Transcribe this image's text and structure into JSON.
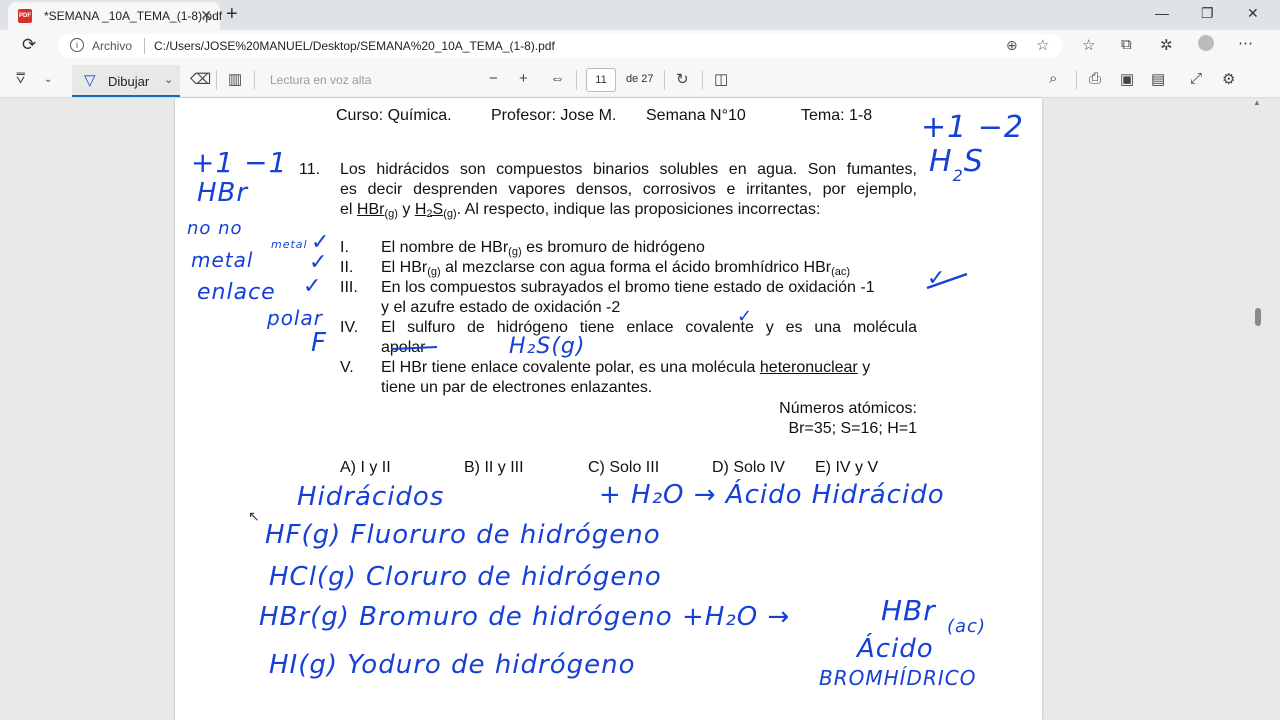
{
  "browser": {
    "tab_title": "*SEMANA _10A_TEMA_(1-8).pdf",
    "address_label": "Archivo",
    "url": "C:/Users/JOSE%20MANUEL/Desktop/SEMANA%20_10A_TEMA_(1-8).pdf"
  },
  "pdf_toolbar": {
    "draw_label": "Dibujar",
    "read_aloud_label": "Lectura en voz alta",
    "current_page": "11",
    "page_of": "de 27"
  },
  "document": {
    "header": {
      "course": "Curso: Química.",
      "teacher": "Profesor: Jose M.",
      "week": "Semana N°10",
      "topic": "Tema: 1-8"
    },
    "question_number": "11.",
    "intro_line1": "Los hidrácidos son compuestos binarios solubles en agua. Son fumantes,",
    "intro_line2": "es decir desprenden vapores densos, corrosivos e irritantes, por ejemplo,",
    "intro_el": "el",
    "intro_hbr": "HBr",
    "state_g": "(g)",
    "intro_y": "y",
    "intro_h2s": "H",
    "intro_h2s_sub": "2",
    "intro_h2s_s": "S",
    "intro_tail": ". Al respecto, indique las proposiciones incorrectas:",
    "roman_1": "I.",
    "prop_1a": "El nombre de HBr",
    "prop_1b": " es bromuro de hidrógeno",
    "roman_2": "II.",
    "prop_2a": "El HBr",
    "prop_2b": " al mezclarse con agua forma el ácido bromhídrico HBr",
    "state_ac": "(ac)",
    "roman_3": "III.",
    "prop_3_line1": "En los compuestos subrayados el bromo tiene estado de oxidación -1",
    "prop_3_line2": "y el azufre estado de oxidación -2",
    "roman_4": "IV.",
    "prop_4_line1": "El sulfuro de hidrógeno tiene enlace covalente y es una molécula",
    "prop_4_line2": "apolar",
    "roman_5": "V.",
    "prop_5a": "El HBr tiene enlace covalente polar, es una molécula",
    "prop_5_underlined": "heteronuclear",
    "prop_5b": " y",
    "prop_5_line2": "tiene un par de electrones enlazantes.",
    "atomic_title": "Números atómicos:",
    "atomic_values": "Br=35; S=16; H=1",
    "option_a": "A) I y II",
    "option_b": "B) II y III",
    "option_c": "C) Solo III",
    "option_d": "D) Solo IV",
    "option_e": "E) IV y V"
  },
  "handwriting": {
    "ox_left": "+1 −1",
    "hbr": "HBr",
    "no_no": "no   no",
    "metal_small": "metal",
    "metal": "metal",
    "enlace": "enlace",
    "polar": "polar",
    "f_mark": "F",
    "ox_right": "+1 −2",
    "h2s_h": "H",
    "h2s_2": "2",
    "h2s_s": "S",
    "h2s_g": "H₂S(g)",
    "check_1": "✓",
    "check_2": "✓",
    "check_3": "✓",
    "check_4": "✓",
    "check_5": "✓",
    "hidracidos": "Hidrácidos",
    "plus_h2o": "+  H₂O  →  Ácido  Hidrácido",
    "line_hf": "HF(g)  Fluoruro de hidrógeno",
    "line_hcl": "HCl(g)  Cloruro de hidrógeno",
    "line_hbr": "HBr(g)  Bromuro  de  hidrógeno  +H₂O →",
    "hbr_ac": "HBr",
    "ac": "(ac)",
    "line_hi": "HI(g)  Yoduro  de  hidrógeno",
    "acido": "Ácido",
    "bromhidrico": "BROMHÍDRICO"
  },
  "colors": {
    "ink": "#1640d6",
    "accent": "#0f6cbd"
  }
}
